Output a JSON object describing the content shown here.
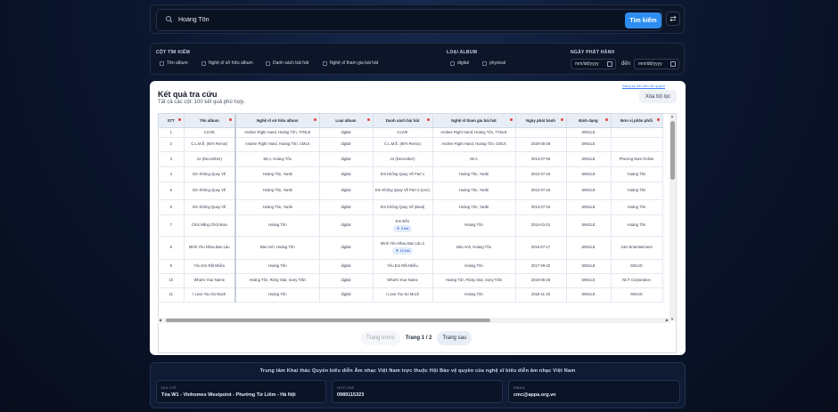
{
  "search": {
    "value": "Hoàng Tôn",
    "button_label": "Tìm kiếm"
  },
  "filters": {
    "columns_label": "CỘT TÌM KIẾM",
    "columns": [
      "Tên album",
      "Nghệ sĩ sở hữu album",
      "Danh sách bài hát",
      "Nghệ sĩ tham gia bài hát"
    ],
    "album_type_label": "LOẠI ALBUM",
    "album_types": [
      "digital",
      "physical"
    ],
    "release_date_label": "NGÀY PHÁT HÀNH",
    "date_from_placeholder": "mm/dd/yyyy",
    "date_to_label": "đến",
    "date_to_placeholder": "mm/dd/yyyy"
  },
  "results": {
    "title": "Kết quả tra cứu",
    "subtitle": "Tất cả các cột: 100 kết quả phù hợp.",
    "fine_link": "Đăng ký bởi viên dữ quyền",
    "clear_label": "Xóa bộ lọc",
    "columns": [
      "STT",
      "Tên album",
      "Nghệ sĩ sở hữu album",
      "Loại album",
      "Danh sách bài hát",
      "Nghệ sĩ tham gia bài hát",
      "Ngày phát hành",
      "Định dạng",
      "Đơn vị phân phối"
    ],
    "rows": [
      {
        "stt": "1",
        "album": "CLIVE",
        "owner": "Andree Right Hand, Hoàng Tôn, TYNLE",
        "type": "digital",
        "songs": "CLIVE",
        "more": "",
        "artists": "Andree Right Hand, Hoàng Tôn, TYNLE",
        "date": "",
        "format": "SINGLE",
        "dist": ""
      },
      {
        "stt": "2",
        "album": "C.L.M.Ế. (80's Remix)",
        "owner": "Andree Right Hand, Hoàng Tôn, CM1X",
        "type": "digital",
        "songs": "C.L.M.Ế. (80's Remix)",
        "more": "",
        "artists": "Andree Right Hand, Hoàng Tôn, CM1X",
        "date": "2020-05-28",
        "format": "SINGLE",
        "dist": ""
      },
      {
        "stt": "3",
        "album": "12 (December)",
        "owner": "Mr.A, Hoàng Tôn",
        "type": "digital",
        "songs": "12 (December)",
        "more": "",
        "artists": "Mr.A",
        "date": "2013-07-05",
        "format": "SINGLE",
        "dist": "Phương Nam Online"
      },
      {
        "stt": "4",
        "album": "Em Không Quay Về",
        "owner": "Hoàng Tôn, Yanbi",
        "type": "digital",
        "songs": "Em Không Quay Về Part 1",
        "more": "",
        "artists": "Hoàng Tôn, Yanbi",
        "date": "2013-07-16",
        "format": "SINGLE",
        "dist": "Hoàng Tôn"
      },
      {
        "stt": "5",
        "album": "Em Không Quay Về",
        "owner": "Hoàng Tôn, Yanbi",
        "type": "digital",
        "songs": "Em Không Quay Về Part 2 (Live)",
        "more": "",
        "artists": "Hoàng Tôn, Yanbi",
        "date": "2013-07-16",
        "format": "SINGLE",
        "dist": "Hoàng Tôn"
      },
      {
        "stt": "6",
        "album": "Em Không Quay Về",
        "owner": "Hoàng Tôn, Yanbi",
        "type": "digital",
        "songs": "Em Không Quay Về (Beat)",
        "more": "",
        "artists": "Hoàng Tôn, Yanbi",
        "date": "2013-07-16",
        "format": "SINGLE",
        "dist": "Hoàng Tôn"
      },
      {
        "stt": "7",
        "album": "Chút Nắng Chút Mưa",
        "owner": "Hoàng Tôn",
        "type": "digital",
        "songs": "Em Đến",
        "more": "▼ 3 bài",
        "artists": "Hoàng Tôn",
        "date": "2014-01-01",
        "format": "SINGLE",
        "dist": "Hoàng Tôn"
      },
      {
        "stt": "8",
        "album": "Mình Yêu Nhau Bao Lâu",
        "owner": "Bảo Anh, Hoàng Tôn",
        "type": "digital",
        "songs": "Mình Yêu Nhau Bao Lâu 2",
        "more": "▼ 10 bài",
        "artists": "Bảo Anh, Hoàng Tôn",
        "date": "2016-07-17",
        "format": "SINGLE",
        "dist": "A&A Entertainment"
      },
      {
        "stt": "9",
        "album": "Yêu Em Rất Nhiều",
        "owner": "Hoàng Tôn",
        "type": "digital",
        "songs": "Yêu Em Rất Nhiều",
        "more": "",
        "artists": "Hoàng Tôn",
        "date": "2017-09-22",
        "format": "SINGLE",
        "dist": "MIXUS"
      },
      {
        "stt": "10",
        "album": "What's Your Name",
        "owner": "Hoàng Tôn, Ricky Star, Sony Trần",
        "type": "digital",
        "songs": "What's Your Name",
        "more": "",
        "artists": "Hoàng Tôn, Ricky Star, Sony Trần",
        "date": "2018-05-28",
        "format": "SINGLE",
        "dist": "NCT Corporation"
      },
      {
        "stt": "11",
        "album": "I Love You So Much",
        "owner": "Hoàng Tôn",
        "type": "digital",
        "songs": "I Love You So Much",
        "more": "",
        "artists": "Hoàng Tôn",
        "date": "2018-11-15",
        "format": "SINGLE",
        "dist": "MIXUS"
      }
    ]
  },
  "pager": {
    "prev_label": "Trang trước",
    "page_label": "Trang 1 / 2",
    "next_label": "Trang sau"
  },
  "footer": {
    "title": "Trung tâm Khai thác Quyền biểu diễn Âm nhạc Việt Nam trực thuộc Hội Bảo vệ quyền của nghệ sĩ biểu diễn âm nhạc Việt Nam",
    "address_label": "ĐỊA CHỈ",
    "address_value": "Tòa W1 - Vinhomes Westpoint - Phường Từ Liêm - Hà Nội",
    "hotline_label": "HOTLINE",
    "hotline_value": "0989115323",
    "email_label": "EMAIL",
    "email_value": "cmc@appa.org.vn"
  },
  "colors": {
    "accent": "#2d8ef0",
    "background": "#0c1730",
    "card": "#ffffff"
  }
}
